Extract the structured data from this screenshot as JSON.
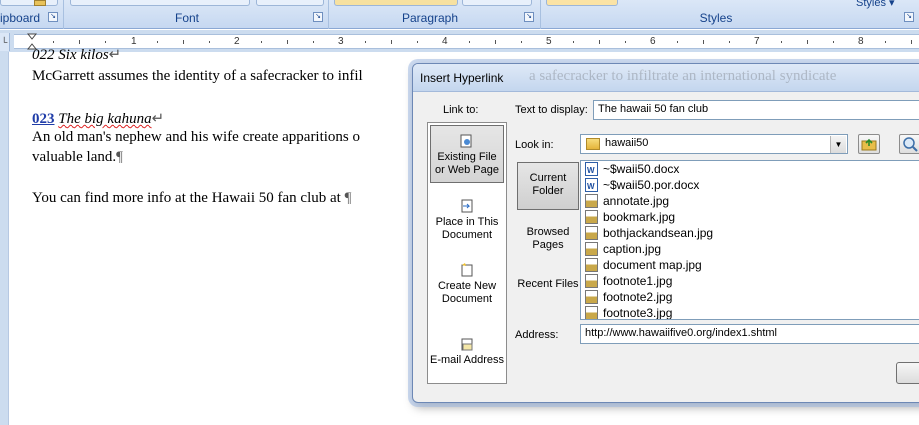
{
  "ribbon": {
    "groups": [
      {
        "label": "ipboard"
      },
      {
        "label": "Font"
      },
      {
        "label": "Paragraph"
      },
      {
        "label": "Styles"
      }
    ],
    "styles_label": "Styles"
  },
  "ruler": {
    "numbers": [
      "1",
      "2",
      "3",
      "4",
      "5",
      "6",
      "7",
      "8"
    ]
  },
  "document": {
    "line_top": "022 Six kilos",
    "line1": "McGarrett assumes the identity of a safecracker to infil",
    "ep_number": "023",
    "ep_title": "The big kahuna",
    "line2": "An old man's nephew and his wife create apparitions o",
    "line3": "valuable land.",
    "line4": "You can find more info at the Hawaii 50 fan club at",
    "pilcrow": "¶",
    "linebreak": "↵",
    "title_ghost": "a safecracker to infiltrate an international syndicate"
  },
  "dialog": {
    "title": "Insert Hyperlink",
    "link_to_label": "Link to:",
    "text_to_display_label": "Text to display:",
    "text_to_display_value": "The hawaii 50 fan club",
    "look_in_label": "Look in:",
    "look_in_value": "hawaii50",
    "address_label": "Address:",
    "address_value": "http://www.hawaiifive0.org/index1.shtml",
    "link_to": [
      {
        "label": "Existing File or Web Page"
      },
      {
        "label": "Place in This Document"
      },
      {
        "label": "Create New Document"
      },
      {
        "label": "E-mail Address"
      }
    ],
    "browse": [
      {
        "label": "Current Folder"
      },
      {
        "label": "Browsed Pages"
      },
      {
        "label": "Recent Files"
      }
    ],
    "files": [
      {
        "name": "~$waii50.docx",
        "type": "docx"
      },
      {
        "name": "~$waii50.por.docx",
        "type": "docx"
      },
      {
        "name": "annotate.jpg",
        "type": "jpg"
      },
      {
        "name": "bookmark.jpg",
        "type": "jpg"
      },
      {
        "name": "bothjackandsean.jpg",
        "type": "jpg"
      },
      {
        "name": "caption.jpg",
        "type": "jpg"
      },
      {
        "name": "document map.jpg",
        "type": "jpg"
      },
      {
        "name": "footnote1.jpg",
        "type": "jpg"
      },
      {
        "name": "footnote2.jpg",
        "type": "jpg"
      },
      {
        "name": "footnote3.jpg",
        "type": "jpg"
      }
    ],
    "icons": {
      "up_folder": "up-folder-icon",
      "browse_web": "browse-web-icon",
      "dropdown": "chevron-down-icon"
    }
  }
}
